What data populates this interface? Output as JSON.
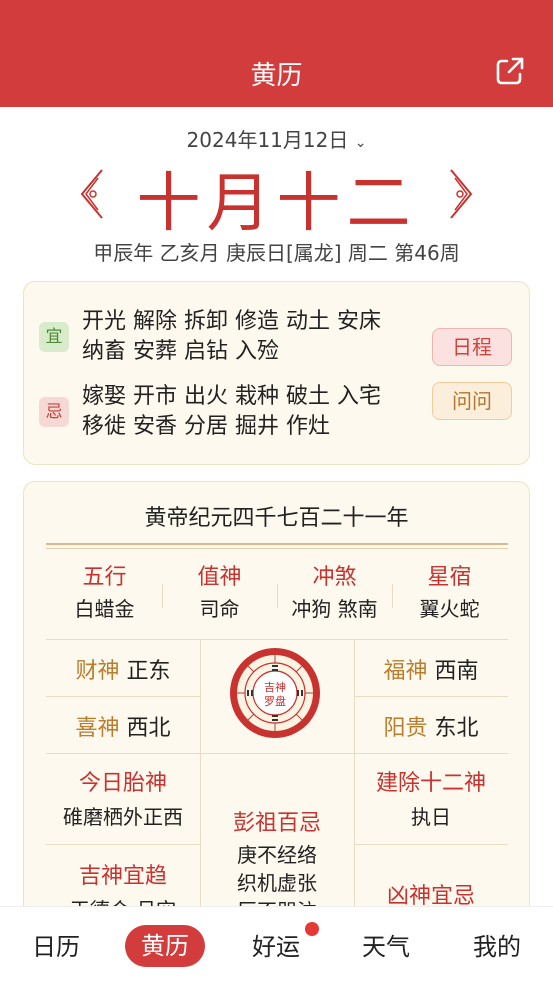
{
  "header": {
    "title": "黄历"
  },
  "date": {
    "solar": "2024年11月12日",
    "lunar": "十月十二",
    "ganzhi": "甲辰年 乙亥月 庚辰日[属龙] 周二 第46周"
  },
  "yi": {
    "badge": "宜",
    "line1": "开光 解除 拆卸 修造 动土 安床",
    "line2": "纳畜 安葬 启钻 入殓"
  },
  "ji": {
    "badge": "忌",
    "line1": "嫁娶 开市 出火 栽种 破土 入宅",
    "line2": "移徙 安香 分居 掘井 作灶"
  },
  "buttons": {
    "schedule": "日程",
    "ask": "问问"
  },
  "details": {
    "era": "黄帝纪元四千七百二十一年",
    "cols": [
      {
        "h": "五行",
        "v": "白蜡金"
      },
      {
        "h": "值神",
        "v": "司命"
      },
      {
        "h": "冲煞",
        "v": "冲狗 煞南"
      },
      {
        "h": "星宿",
        "v": "翼火蛇"
      }
    ],
    "caishen": {
      "h": "财神",
      "v": "正东"
    },
    "fushen": {
      "h": "福神",
      "v": "西南"
    },
    "xishen": {
      "h": "喜神",
      "v": "西北"
    },
    "yanggui": {
      "h": "阳贵",
      "v": "东北"
    },
    "compass": {
      "l1": "吉神",
      "l2": "罗盘"
    },
    "taishen": {
      "h": "今日胎神",
      "v": "碓磨栖外正西"
    },
    "pengzu": {
      "h": "彭祖百忌",
      "v1": "庚不经络",
      "v2": "织机虚张",
      "v3": "辰不哭泣"
    },
    "jianchu": {
      "h": "建除十二神",
      "v": "执日"
    },
    "jishen": {
      "h": "吉神宜趋",
      "v": "天德合 月空"
    },
    "xiongshen": {
      "h": "凶神宜忌"
    }
  },
  "tabs": [
    "日历",
    "黄历",
    "好运",
    "天气",
    "我的"
  ],
  "colors": {
    "primary": "#d23c3c",
    "accent_red": "#c8322f",
    "gold": "#b97d2c"
  }
}
